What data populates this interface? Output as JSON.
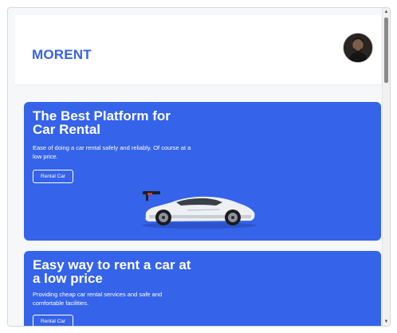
{
  "navbar": {
    "logo": "MORENT",
    "avatar_icon": "user-avatar"
  },
  "hero_cards": [
    {
      "title": "The Best Platform for Car Rental",
      "description": "Ease of doing a car rental safely and reliably. Of course at a low price.",
      "button_label": "Rental Car",
      "image_icon": "white-sports-car"
    },
    {
      "title": "Easy way to rent a car at a low price",
      "description": "Providing cheap car rental services and safe and comfortable facilities.",
      "button_label": "Rental Car"
    }
  ],
  "colors": {
    "brand": "#3563e9",
    "card_background": "#3563e9",
    "page_background": "#f6f7f9"
  },
  "scrollbar": {
    "up_arrow": "▲",
    "down_arrow": "▼"
  }
}
